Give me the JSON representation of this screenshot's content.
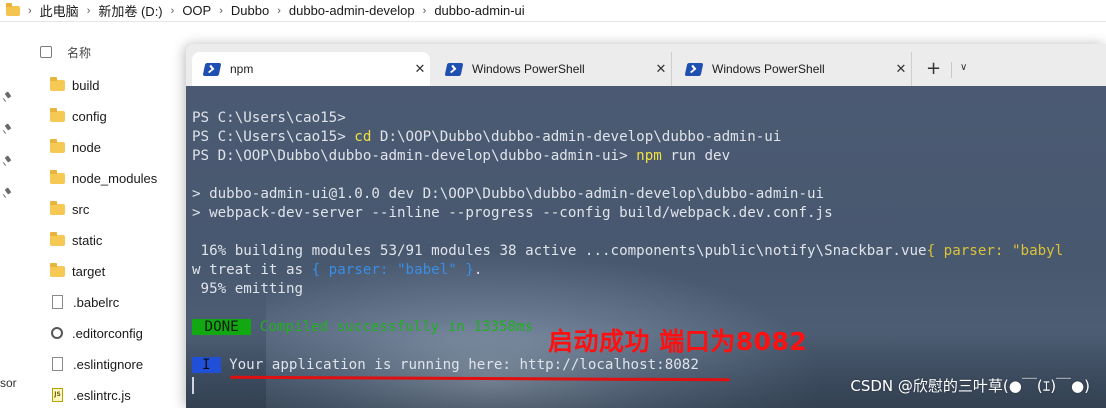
{
  "explorer": {
    "breadcrumb": [
      "此电脑",
      "新加卷 (D:)",
      "OOP",
      "Dubbo",
      "dubbo-admin-develop",
      "dubbo-admin-ui"
    ],
    "column_name": "名称",
    "files": [
      {
        "name": "build",
        "type": "folder"
      },
      {
        "name": "config",
        "type": "folder"
      },
      {
        "name": "node",
        "type": "folder"
      },
      {
        "name": "node_modules",
        "type": "folder"
      },
      {
        "name": "src",
        "type": "folder"
      },
      {
        "name": "static",
        "type": "folder"
      },
      {
        "name": "target",
        "type": "folder"
      },
      {
        "name": ".babelrc",
        "type": "file"
      },
      {
        "name": ".editorconfig",
        "type": "config"
      },
      {
        "name": ".eslintignore",
        "type": "file"
      },
      {
        "name": ".eslintrc.js",
        "type": "js"
      }
    ],
    "left_cut_text": "sor"
  },
  "terminal": {
    "tabs": [
      {
        "label": "npm",
        "active": true
      },
      {
        "label": "Windows PowerShell",
        "active": false
      },
      {
        "label": "Windows PowerShell",
        "active": false
      }
    ],
    "new_tab_symbol": "+",
    "dropdown_symbol": "∨",
    "close_symbol": "✕",
    "lines": {
      "l1": "PS C:\\Users\\cao15>",
      "l2_prompt": "PS C:\\Users\\cao15> ",
      "l2_cmd": "cd",
      "l2_rest": " D:\\OOP\\Dubbo\\dubbo-admin-develop\\dubbo-admin-ui",
      "l3_prompt": "PS D:\\OOP\\Dubbo\\dubbo-admin-develop\\dubbo-admin-ui> ",
      "l3_cmd": "npm",
      "l3_rest": " run dev",
      "l4": "> dubbo-admin-ui@1.0.0 dev D:\\OOP\\Dubbo\\dubbo-admin-develop\\dubbo-admin-ui",
      "l5": "> webpack-dev-server --inline --progress --config build/webpack.dev.conf.js",
      "l6_main": " 16% building modules 53/91 modules 38 active ...components\\public\\notify\\Snackbar.vue",
      "l6_tail": "{ parser: \"babyl",
      "l7_start": "w treat it as ",
      "l7_blue": "{ parser: \"babel\" }",
      "l7_end": ".",
      "l8": " 95% emitting",
      "l9_badge": " DONE ",
      "l9_text": " Compiled successfully in 13358ms",
      "l10_badge": "I",
      "l10_text": " Your application is running here: http://localhost:8082"
    },
    "annotation": "启动成功  端口为8082",
    "watermark": "CSDN @欣慰的三叶草(●￣(ｴ)￣●)"
  },
  "colors": {
    "console_bg": "#48586f",
    "annotation_red": "#ff1010",
    "done_green": "#11a812",
    "info_blue": "#2050d8",
    "command_yellow": "#f0e046"
  }
}
